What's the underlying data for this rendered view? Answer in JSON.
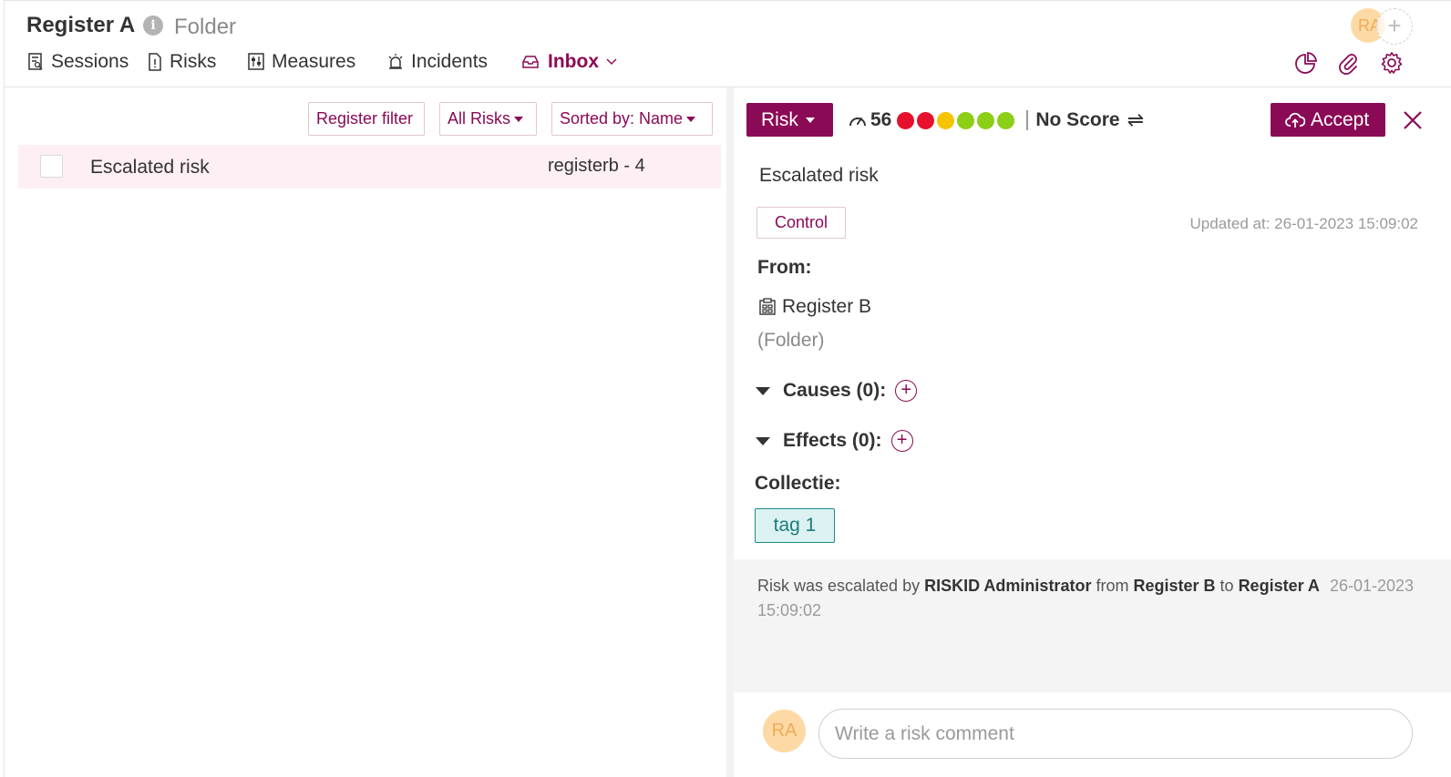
{
  "header": {
    "title": "Register A",
    "info_icon": "i",
    "subtitle": "Folder",
    "avatar_initials": "RA",
    "add_user_symbol": "+"
  },
  "nav": {
    "tabs": [
      {
        "label": "Sessions",
        "icon": "sessions-icon"
      },
      {
        "label": "Risks",
        "icon": "document-icon"
      },
      {
        "label": "Measures",
        "icon": "measures-icon"
      },
      {
        "label": "Incidents",
        "icon": "alarm-icon"
      },
      {
        "label": "Inbox",
        "icon": "inbox-icon",
        "active": true
      }
    ],
    "toolbar_icons": [
      "pie-chart-icon",
      "paperclip-icon",
      "gear-icon"
    ]
  },
  "list": {
    "filters": {
      "register_filter": "Register filter",
      "all_risks": "All Risks",
      "sort": "Sorted by: Name"
    },
    "rows": [
      {
        "name": "Escalated risk",
        "ref": "registerb - 4"
      }
    ]
  },
  "detail": {
    "type_button": "Risk",
    "score": "56",
    "score_dots": [
      "#e8112d",
      "#e8112d",
      "#f5c400",
      "#8ccf17",
      "#8ccf17",
      "#8ccf17"
    ],
    "no_score": "No Score",
    "swap_symbol": "⇌",
    "accept_label": "Accept",
    "title": "Escalated risk",
    "category": "Control",
    "updated_at": "Updated at: 26-01-2023 15:09:02",
    "from_label": "From:",
    "from_register": "Register B",
    "from_type": "(Folder)",
    "causes_label": "Causes (0):",
    "effects_label": "Effects (0):",
    "add_symbol": "+",
    "collection_label": "Collectie:",
    "tags": [
      "tag 1"
    ]
  },
  "activity": {
    "prefix": "Risk was escalated by",
    "user": "RISKID Administrator",
    "from_word": "from",
    "from_register": "Register B",
    "to_word": "to",
    "to_register": "Register A",
    "timestamp": "26-01-2023 15:09:02"
  },
  "comment": {
    "avatar_initials": "RA",
    "placeholder": "Write a risk comment"
  },
  "colors": {
    "accent": "#8b0a55",
    "row_highlight": "#fdeff4",
    "tag_bg": "#dcf2f2",
    "tag_border": "#1e8a8a",
    "avatar_bg": "#fddaa5"
  }
}
